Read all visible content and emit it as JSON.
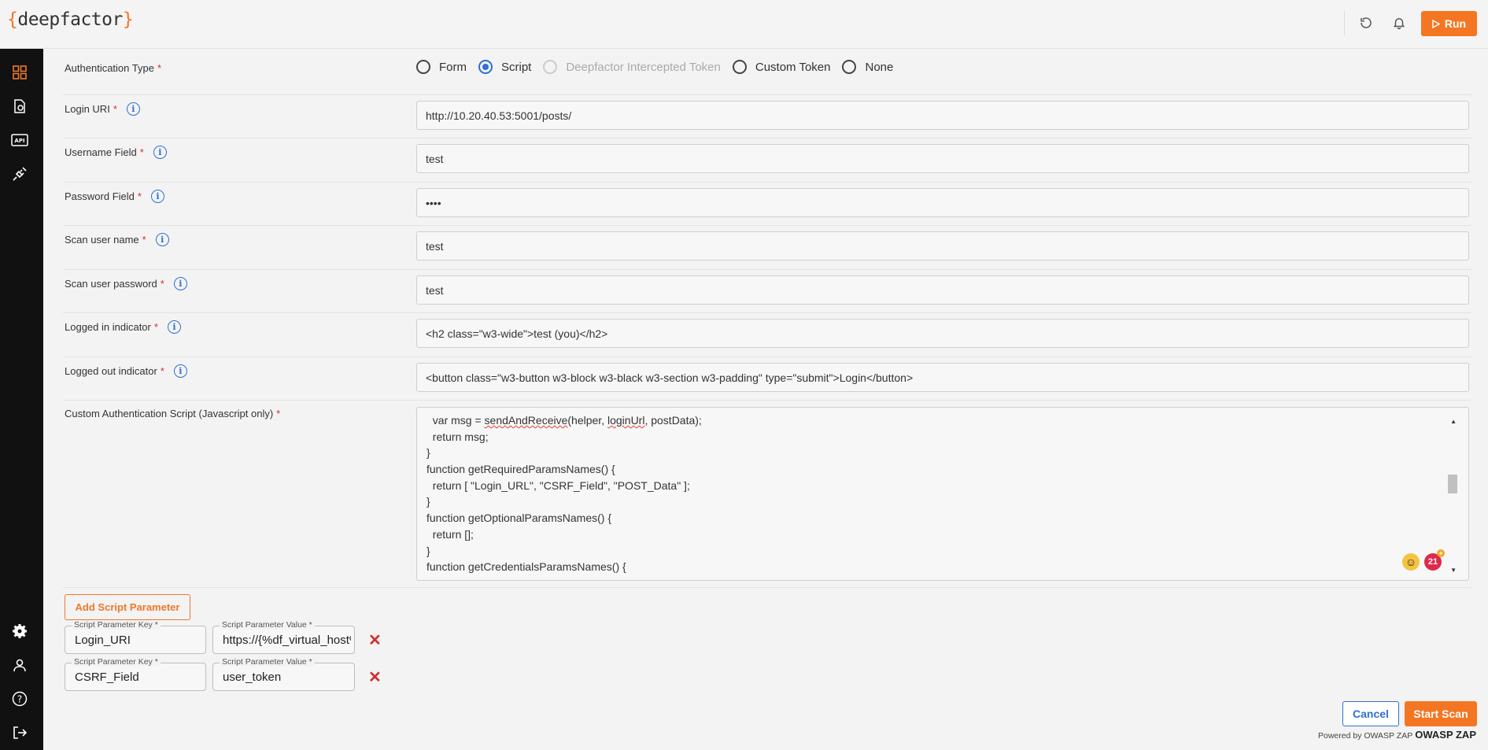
{
  "app": {
    "logo_left": "{",
    "logo_text": "deepfactor",
    "logo_right": "}"
  },
  "header": {
    "icons": [
      "refresh-icon",
      "bell-icon"
    ],
    "run_label": "Run"
  },
  "sidebar": {
    "top_icons": [
      "dashboard-icon",
      "document-icon",
      "api-icon",
      "plug-icon"
    ],
    "bottom_icons": [
      "gear-icon",
      "user-icon",
      "help-icon",
      "logout-icon"
    ]
  },
  "form": {
    "auth_type": {
      "label": "Authentication Type",
      "options": [
        "Form",
        "Script",
        "Deepfactor Intercepted Token",
        "Custom Token",
        "None"
      ],
      "selected": "Script"
    },
    "login_uri": {
      "label": "Login URI",
      "value": "http://10.20.40.53:5001/posts/"
    },
    "username_field": {
      "label": "Username Field",
      "value": "test"
    },
    "password_field": {
      "label": "Password Field",
      "value": "••••"
    },
    "scan_user_name": {
      "label": "Scan user name",
      "value": "test"
    },
    "scan_user_password": {
      "label": "Scan user password",
      "value": "test"
    },
    "logged_in_indicator": {
      "label": "Logged in indicator",
      "value": "<h2 class=\"w3-wide\">test (you)</h2>"
    },
    "logged_out_indicator": {
      "label": "Logged out indicator",
      "value": "<button class=\"w3-button w3-block w3-black w3-section w3-padding\" type=\"submit\">Login</button>"
    },
    "custom_script": {
      "label": "Custom Authentication Script (Javascript only)",
      "lines": [
        "  var msg = sendAndReceive(helper, loginUrl, postData);",
        "  return msg;",
        "}",
        "function getRequiredParamsNames() {",
        "  return [ \"Login_URL\", \"CSRF_Field\", \"POST_Data\" ];",
        "}",
        "function getOptionalParamsNames() {",
        "  return [];",
        "}",
        "function getCredentialsParamsNames() {"
      ],
      "badge_count": "21"
    },
    "add_param_label": "Add Script Parameter",
    "params": [
      {
        "key_label": "Script Parameter Key *",
        "key": "Login_URI",
        "value_label": "Script Parameter Value *",
        "value": "https://{%df_virtual_host%}"
      },
      {
        "key_label": "Script Parameter Key *",
        "key": "CSRF_Field",
        "value_label": "Script Parameter Value *",
        "value": "user_token"
      }
    ]
  },
  "footer": {
    "cancel_label": "Cancel",
    "start_label": "Start Scan",
    "powered_by": "Powered by OWASP ZAP",
    "zap_logo": "OWASP ZAP"
  },
  "colors": {
    "accent": "#f47623",
    "link": "#2f6fd6",
    "danger": "#d32f2f",
    "sidebar": "#111111"
  }
}
